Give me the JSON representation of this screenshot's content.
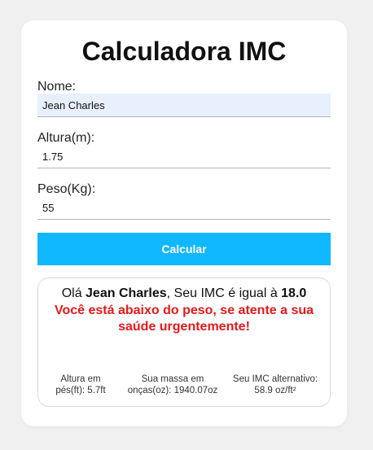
{
  "title": "Calculadora IMC",
  "form": {
    "name_label": "Nome:",
    "name_value": "Jean Charles",
    "height_label": "Altura(m):",
    "height_value": "1.75",
    "weight_label": "Peso(Kg):",
    "weight_value": "55",
    "submit_label": "Calcular"
  },
  "result": {
    "greeting_prefix": "Olá ",
    "name": "Jean Charles",
    "greeting_middle": ", Seu IMC é igual à ",
    "imc": "18.0",
    "warning": "Você está abaixo do peso, se atente a sua saúde urgentemente!",
    "height_feet": "Altura em pés(ft): 5.7ft",
    "mass_ounces": "Sua massa em onças(oz): 1940.07oz",
    "imc_alt": "Seu IMC alternativo: 58.9 oz/ft²"
  },
  "colors": {
    "accent": "#0fb7ff",
    "warning": "#e51a1a",
    "autofill": "#e8f0fe"
  }
}
